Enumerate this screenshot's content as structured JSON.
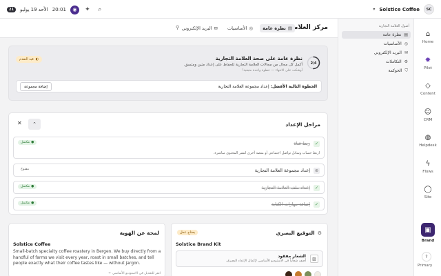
{
  "topbar": {
    "badge": "21",
    "date": "الأحد 19 يوليو",
    "time": "20:01",
    "org_initials": "SC",
    "org_name": "Solstice Coffee"
  },
  "rail": {
    "items": [
      {
        "label": "Home",
        "icon": "home-icon"
      },
      {
        "label": "Pilot",
        "icon": "pilot-icon"
      },
      {
        "label": "Content",
        "icon": "tag-icon"
      },
      {
        "label": "CRM",
        "icon": "users-icon"
      },
      {
        "label": "Helpdesk",
        "icon": "helpdesk-icon"
      },
      {
        "label": "Flows",
        "icon": "bolt-icon"
      },
      {
        "label": "Site",
        "icon": "globe-icon"
      },
      {
        "label": "Brand",
        "icon": "brand-icon"
      }
    ],
    "user_initial": "?",
    "user_label": "Primary"
  },
  "subnav": {
    "heading": "أصول العلامة التجارية",
    "items": [
      {
        "label": "نظرة عامة"
      },
      {
        "label": "الأساسيات"
      },
      {
        "label": "البريد الإلكتروني"
      },
      {
        "label": "التكاملات"
      },
      {
        "label": "الحوكمة"
      }
    ]
  },
  "header": {
    "title": "مركز العلامة ...",
    "tabs": [
      {
        "label": "نظرة عامة"
      },
      {
        "label": "الأساسيات"
      },
      {
        "label": "البريد الإلكتروني"
      }
    ]
  },
  "health": {
    "progress": "2/4",
    "progress_fraction": 0.5,
    "title": "نظرة عامة على صحة العلامة التجارية",
    "subtitle": "أكمل كل مجال من مجالات العلامة التجارية للحفاظ على إعداد متين ومتسق.",
    "subtitle2": "أوشكت على الانتهاء — خطوة واحدة متبقية!",
    "badge": "قيد التقدم",
    "next_step_label": "الخطوة التالية الأفضل:",
    "next_step_value": "إعداد مجموعة العلامة التجارية",
    "next_step_button": "إضافة مجموعة"
  },
  "setup": {
    "title": "مراحل الإعداد",
    "steps": [
      {
        "label": "ربط قناة",
        "status": "مكتمل",
        "done": true,
        "desc": "اربط حساب وسائل تواصل اجتماعي أو منصة أخرى لنشر المحتوى مباشرة."
      },
      {
        "label": "إعداد مجموعة العلامة التجارية",
        "status": "مفتوح",
        "done": false
      },
      {
        "label": "إعداد ملف العلامة التجارية",
        "status": "مكتمل",
        "done": true
      },
      {
        "label": "إضافة مهارات الكتابة",
        "status": "مكتمل",
        "done": true
      }
    ]
  },
  "identity": {
    "title": "لمحة عن الهوية",
    "name": "Solstice Coffee",
    "desc": "Small-batch specialty coffee roastery in Bergen. We buy directly from a handful of farms we visit every year, roast in small batches, and tell people exactly what their coffee tastes like — without jargon.",
    "hint": "انقر للتعديل في الاستوديو الأساسي ←"
  },
  "visual": {
    "title": "التوقيع البصري",
    "badge": "يحتاج عمل",
    "kit_name": "Solstice Brand Kit",
    "logo_title": "الشعار مفقود",
    "logo_sub": "أضف شعاراً في الاستوديو الأساسي لإكمال الإعداد البصري.",
    "swatches": [
      "#f1ede4",
      "#7b8f5a",
      "#c57b2c",
      "#3a2415"
    ]
  }
}
